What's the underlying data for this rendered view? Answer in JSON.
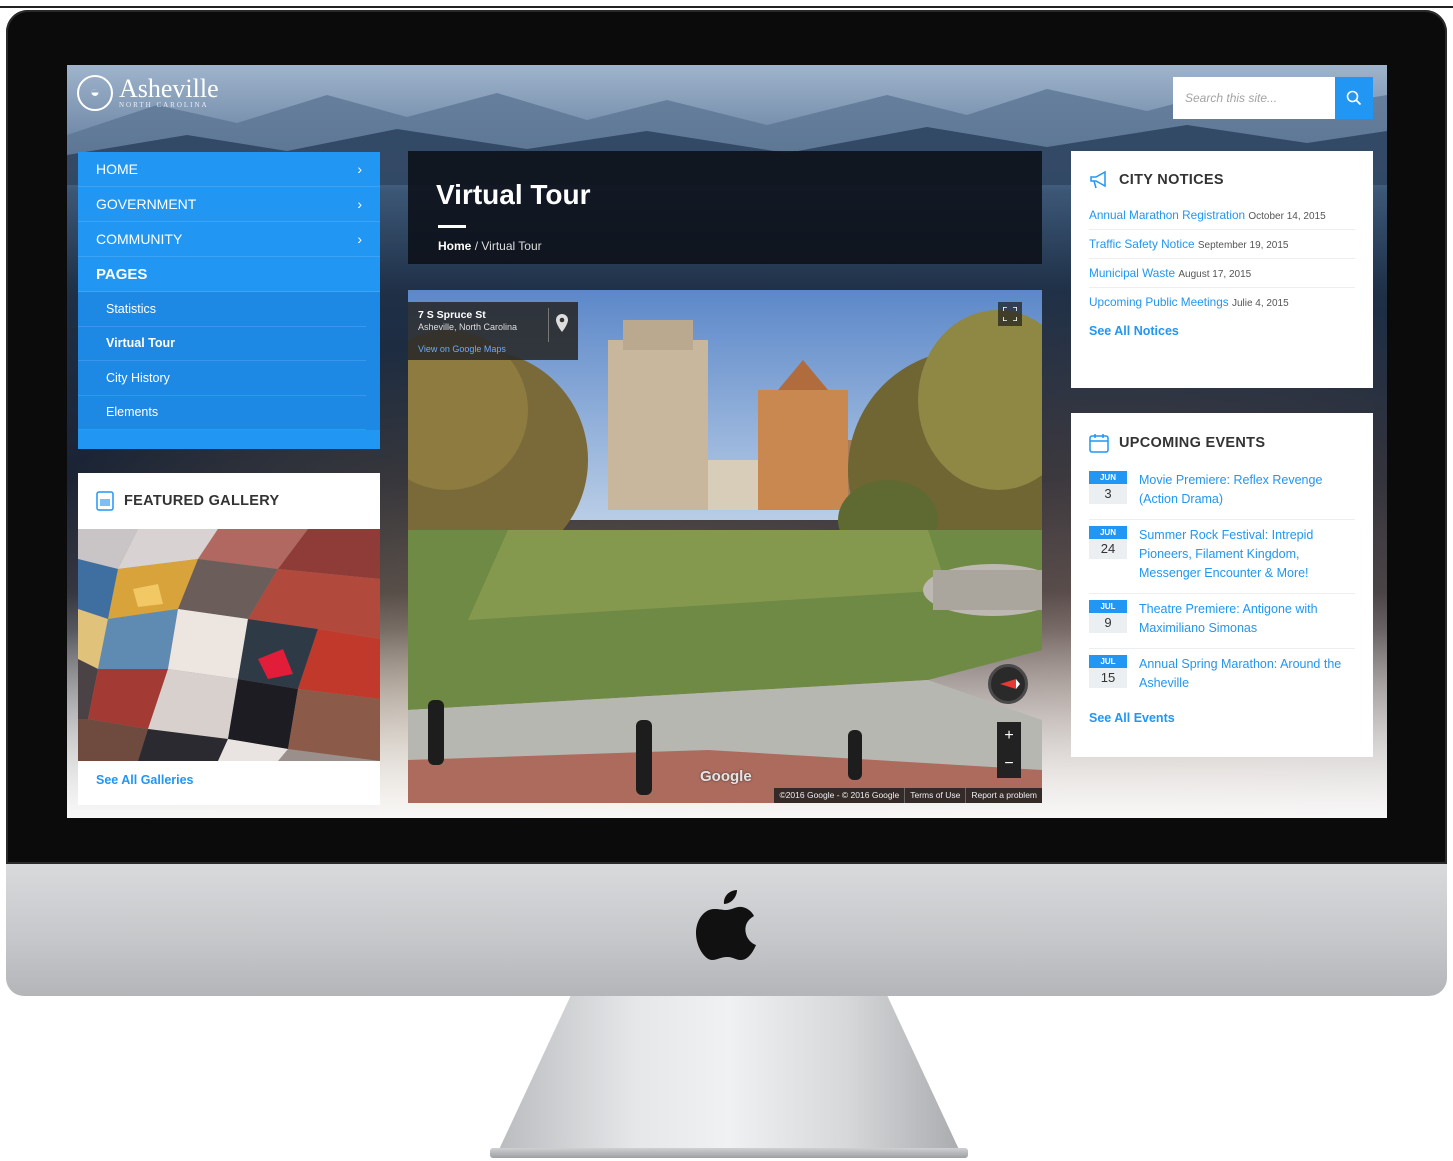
{
  "site": {
    "logo_name": "Asheville",
    "logo_subtitle": "NORTH CAROLINA",
    "search_placeholder": "Search this site..."
  },
  "nav": {
    "items": [
      {
        "label": "HOME"
      },
      {
        "label": "GOVERNMENT"
      },
      {
        "label": "COMMUNITY"
      }
    ],
    "pages_label": "PAGES",
    "subitems": [
      {
        "label": "Statistics"
      },
      {
        "label": "Virtual Tour"
      },
      {
        "label": "City History"
      },
      {
        "label": "Elements"
      }
    ]
  },
  "gallery": {
    "title": "FEATURED GALLERY",
    "link": "See All Galleries"
  },
  "page": {
    "title": "Virtual Tour",
    "breadcrumb_home": "Home",
    "breadcrumb_sep": "/",
    "breadcrumb_current": "Virtual Tour"
  },
  "street_view": {
    "address": "7 S Spruce St",
    "city": "Asheville, North Carolina",
    "map_link": "View on Google Maps",
    "google_mark": "Google",
    "zoom_in": "+",
    "zoom_out": "−",
    "footer": [
      "©2016 Google - © 2016 Google",
      "Terms of Use",
      "Report a problem"
    ]
  },
  "notices": {
    "title": "CITY NOTICES",
    "items": [
      {
        "title": "Annual Marathon Registration",
        "date": "October 14, 2015"
      },
      {
        "title": "Traffic Safety Notice",
        "date": "September 19, 2015"
      },
      {
        "title": "Municipal Waste",
        "date": "August 17, 2015"
      },
      {
        "title": "Upcoming Public Meetings",
        "date": "Julie 4, 2015"
      }
    ],
    "link": "See All Notices"
  },
  "events": {
    "title": "UPCOMING EVENTS",
    "items": [
      {
        "month": "JUN",
        "day": "3",
        "title": "Movie Premiere: Reflex Revenge (Action Drama)"
      },
      {
        "month": "JUN",
        "day": "24",
        "title": "Summer Rock Festival: Intrepid Pioneers, Filament Kingdom, Messenger Encounter & More!"
      },
      {
        "month": "JUL",
        "day": "9",
        "title": "Theatre Premiere: Antigone with Maximiliano Simonas"
      },
      {
        "month": "JUL",
        "day": "15",
        "title": "Annual Spring Marathon: Around the Asheville"
      }
    ],
    "link": "See All Events"
  },
  "colors": {
    "accent": "#2196f3",
    "nav_sub": "#1e88e5",
    "title_panel": "#0c1018"
  },
  "icons": [
    "search-icon",
    "chevron-right-icon",
    "gallery-icon",
    "megaphone-icon",
    "calendar-icon",
    "map-pin-icon",
    "fullscreen-icon",
    "compass-icon",
    "apple-logo-icon"
  ]
}
